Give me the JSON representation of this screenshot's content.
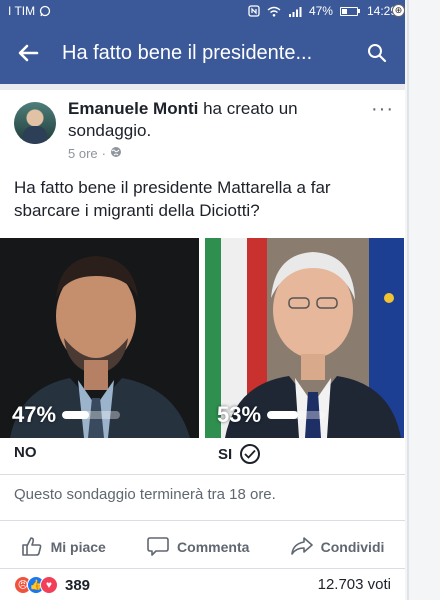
{
  "status_bar": {
    "carrier": "I TIM",
    "battery": "47%",
    "battery_level": 0.47,
    "time": "14:29"
  },
  "app_bar": {
    "title": "Ha fatto bene il presidente..."
  },
  "post": {
    "author": "Emanuele Monti",
    "action": "ha creato un sondaggio.",
    "time": "5 ore",
    "question": "Ha fatto bene il presidente Mattarella a far sbarcare i migranti della Diciotti?"
  },
  "poll": {
    "options": [
      {
        "label": "NO",
        "percent": "47%",
        "value": 0.47,
        "selected": false
      },
      {
        "label": "SI",
        "percent": "53%",
        "value": 0.53,
        "selected": true
      }
    ],
    "ends": "Questo sondaggio terminerà tra 18 ore."
  },
  "actions": {
    "like": "Mi piace",
    "comment": "Commenta",
    "share": "Condividi"
  },
  "footer": {
    "reactions_count": "389",
    "votes": "12.703 voti"
  },
  "colors": {
    "brand": "#3b5998",
    "text": "#1d2129",
    "muted": "#606770"
  }
}
